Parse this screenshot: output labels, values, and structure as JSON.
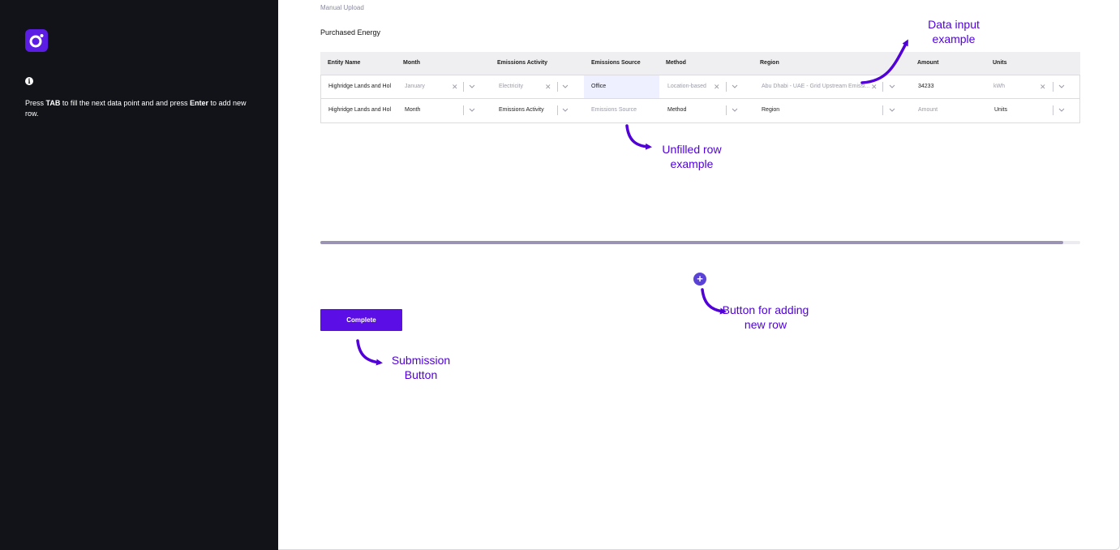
{
  "sidebar": {
    "hint_prefix": "Press ",
    "hint_key1": "TAB",
    "hint_mid": " to fill the next data point and and press ",
    "hint_key2": "Enter",
    "hint_suffix": " to add new row.",
    "info_icon": "i"
  },
  "main": {
    "breadcrumb": "Manual Upload",
    "title": "Purchased Energy",
    "columns": [
      "Entity Name",
      "Month",
      "Emissions Activity",
      "Emissions Source",
      "Method",
      "Region",
      "Amount",
      "Units"
    ],
    "rows": [
      {
        "entity": "Highridge Lands and Hol",
        "month": "January",
        "activity": "Electricity",
        "source": "Office",
        "method": "Location-based",
        "region": "Abu Dhabi - UAE - Grid Upstream Emissi...",
        "amount": "34233",
        "units": "kWh"
      },
      {
        "entity": "Highridge Lands and Hol",
        "month": "Month",
        "activity": "Emissions Activity",
        "source": "Emissions Source",
        "method": "Method",
        "region": "Region",
        "amount": "Amount",
        "units": "Units"
      }
    ],
    "clear_glyph": "✕",
    "progress_fraction": 0.978,
    "add_glyph": "+",
    "complete_label": "Complete"
  },
  "annotations": {
    "data_input": "Data input example",
    "unfilled_row": "Unfilled row example",
    "add_row": "Button for adding new row",
    "submission": "Submission Button"
  },
  "colors": {
    "sidebar_bg": "#111318",
    "brand": "#5b1de3",
    "button": "#5b0ee6",
    "annotation": "#5100d8",
    "highlight_cell": "#eef0ff"
  },
  "icons": [
    "logo-icon",
    "info-icon",
    "clear-icon",
    "chevron-down-icon",
    "plus-icon",
    "arrow-icon"
  ]
}
